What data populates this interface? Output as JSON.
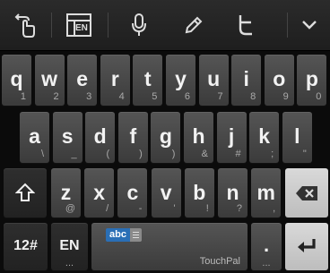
{
  "toolbar": {
    "layout_badge": "EN",
    "icons": [
      "gesture-swipe-icon",
      "keyboard-layout-icon",
      "microphone-icon",
      "pencil-icon",
      "twitter-icon",
      "chevron-down-icon"
    ]
  },
  "rows": {
    "row1": [
      {
        "main": "q",
        "sub": "1"
      },
      {
        "main": "w",
        "sub": "2"
      },
      {
        "main": "e",
        "sub": "3"
      },
      {
        "main": "r",
        "sub": "4"
      },
      {
        "main": "t",
        "sub": "5"
      },
      {
        "main": "y",
        "sub": "6"
      },
      {
        "main": "u",
        "sub": "7"
      },
      {
        "main": "i",
        "sub": "8"
      },
      {
        "main": "o",
        "sub": "9"
      },
      {
        "main": "p",
        "sub": "0"
      }
    ],
    "row2": [
      {
        "main": "a",
        "sub": "\\"
      },
      {
        "main": "s",
        "sub": "_"
      },
      {
        "main": "d",
        "sub": "("
      },
      {
        "main": "f",
        "sub": ")"
      },
      {
        "main": "g",
        "sub": ")"
      },
      {
        "main": "h",
        "sub": "&"
      },
      {
        "main": "j",
        "sub": "#"
      },
      {
        "main": "k",
        "sub": ";"
      },
      {
        "main": "l",
        "sub": "\""
      }
    ],
    "row3": [
      {
        "main": "z",
        "sub": "@"
      },
      {
        "main": "x",
        "sub": "/"
      },
      {
        "main": "c",
        "sub": "-"
      },
      {
        "main": "v",
        "sub": "'"
      },
      {
        "main": "b",
        "sub": "!"
      },
      {
        "main": "n",
        "sub": "?"
      },
      {
        "main": "m",
        "sub": ","
      }
    ]
  },
  "bottom": {
    "symbols_label": "12#",
    "lang_label": "EN",
    "lang_sub": "...",
    "space_chip": "abc",
    "space_brand": "TouchPal",
    "period_label": ".",
    "period_sub": "..."
  },
  "colors": {
    "accent": "#2a6fb6",
    "key": "#474747",
    "dark_key": "#262626",
    "light_key": "#cfcfcf"
  }
}
